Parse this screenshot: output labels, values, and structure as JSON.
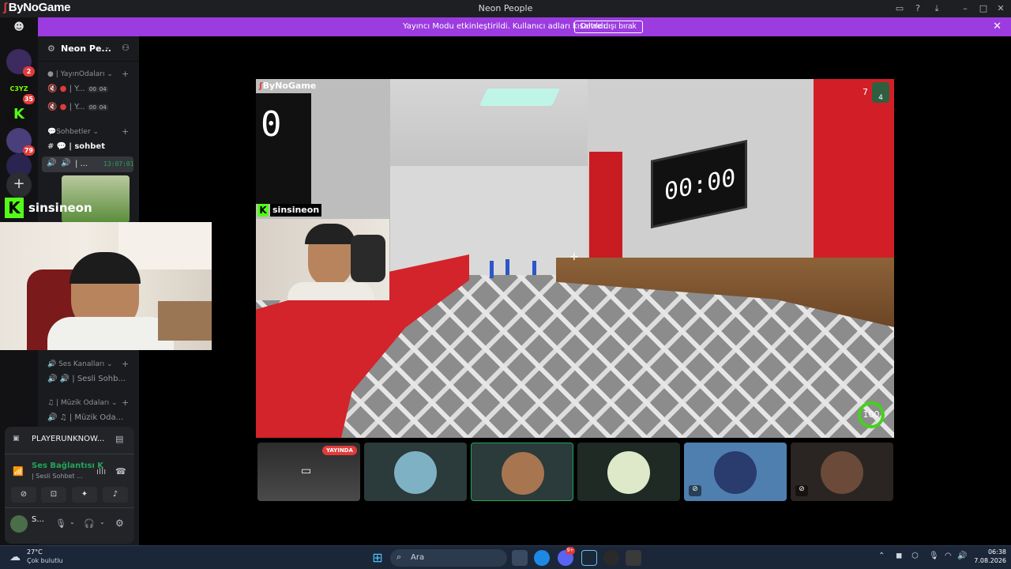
{
  "titlebar": {
    "brand": "ByNoGame",
    "app_title": "Neon People"
  },
  "banner": {
    "text": "Yayıncı Modu etkinleştirildi. Kullanıcı adları kısaltıldı.",
    "button": "Devre dışı bırak"
  },
  "rail": {
    "servers": [
      {
        "name": "discord-home",
        "badge": ""
      },
      {
        "name": "server-1",
        "badge": "2"
      },
      {
        "name": "server-c3yz",
        "badge": "35",
        "label": "C3YZ"
      },
      {
        "name": "server-k",
        "badge": ""
      },
      {
        "name": "server-4",
        "badge": "79"
      },
      {
        "name": "server-5",
        "badge": ""
      }
    ]
  },
  "sidebar": {
    "server_name": "Neon Pe...",
    "categories": [
      {
        "label": "| YayınOdaları"
      },
      {
        "label": "Sohbetler"
      },
      {
        "label": "Ses Kanalları"
      },
      {
        "label": "| Müzik Odaları"
      }
    ],
    "channels": [
      {
        "label": "| Y...",
        "a": "00",
        "b": "04"
      },
      {
        "label": "| Y...",
        "a": "00",
        "b": "04"
      },
      {
        "label": "| sohbet"
      },
      {
        "label": "| ...",
        "time": "13:07:01"
      },
      {
        "label": "| Sesli Sohb..."
      },
      {
        "label": "| Müzik Oda..."
      }
    ],
    "streamer_name": "sinsineon"
  },
  "voice_panel": {
    "game": "PLAYERUNKNOW...",
    "status": "Ses Bağlantısı K",
    "channel": "| Sesli Sohbet ...",
    "user": "S..."
  },
  "stage": {
    "brand": "ByNoGame",
    "player_count": "7",
    "player_sub": "4",
    "clock": "00:00",
    "left_sign": "0",
    "cam_label": "sinsineon",
    "health": "100"
  },
  "tiles": [
    {
      "name": "stream-tile",
      "badge": "YAYINDA"
    },
    {
      "name": "user-tile-1"
    },
    {
      "name": "user-tile-2"
    },
    {
      "name": "user-tile-3"
    },
    {
      "name": "user-tile-4"
    },
    {
      "name": "user-tile-5"
    }
  ],
  "taskbar": {
    "weather_temp": "27°C",
    "weather_text": "Çok bulutlu",
    "search": "Ara",
    "clock_time": "06:38",
    "clock_date": "7.08.2026",
    "notif_badge": "9+"
  },
  "colors": {
    "accent": "#9b3be0",
    "live": "#e23b3b",
    "speaking": "#23a55a"
  }
}
